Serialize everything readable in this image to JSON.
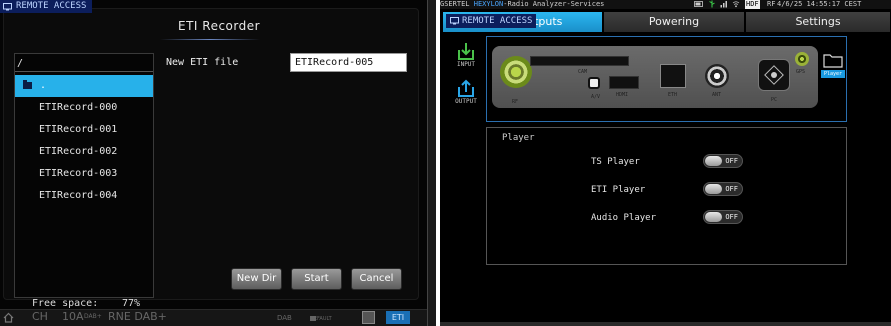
{
  "left": {
    "remote_access": "REMOTE ACCESS",
    "dialog_title": "ETI Recorder",
    "path": "/",
    "selected_entry": ".",
    "files": [
      "ETIRecord-000",
      "ETIRecord-001",
      "ETIRecord-002",
      "ETIRecord-003",
      "ETIRecord-004"
    ],
    "new_file_label": "New ETI file",
    "new_file_value": "ETIRecord-005",
    "buttons": {
      "new_dir": "New Dir",
      "start": "Start",
      "cancel": "Cancel"
    },
    "free_space_label": "Free space:",
    "free_space_value": "77%",
    "bottom_bar": {
      "ch": "CH",
      "channel": "10A",
      "dab_plus": "DAB+",
      "rne": "RNE DAB+",
      "dab": "DAB",
      "default": "DEFAULT",
      "eti": "ETI"
    },
    "accent_color": "#27b1ea"
  },
  "right": {
    "status": {
      "vendor": "GSERTEL",
      "brand": "HEXYLON",
      "app": "-Radio Analyzer-Services",
      "hdf": "HDF",
      "rf": "RF",
      "datetime": "4/6/25 14:55:17 CEST"
    },
    "remote_access": "REMOTE ACCESS",
    "tabs": [
      {
        "label": "s/Outputs",
        "active": true
      },
      {
        "label": "Powering",
        "active": false
      },
      {
        "label": "Settings",
        "active": false
      }
    ],
    "side": {
      "input": "INPUT",
      "output": "OUTPUT"
    },
    "ports": {
      "rf": "RF",
      "cam": "CAM",
      "av": "A/V",
      "hdmi": "HDMI",
      "eth": "ETH",
      "ant": "ANT",
      "pc": "PC",
      "gps": "GPS"
    },
    "player_chip": "Player",
    "panel_title": "Player",
    "options": [
      {
        "label": "TS Player",
        "state": "OFF"
      },
      {
        "label": "ETI Player",
        "state": "OFF"
      },
      {
        "label": "Audio Player",
        "state": "OFF"
      }
    ],
    "accent_color": "#1a9ae0"
  }
}
